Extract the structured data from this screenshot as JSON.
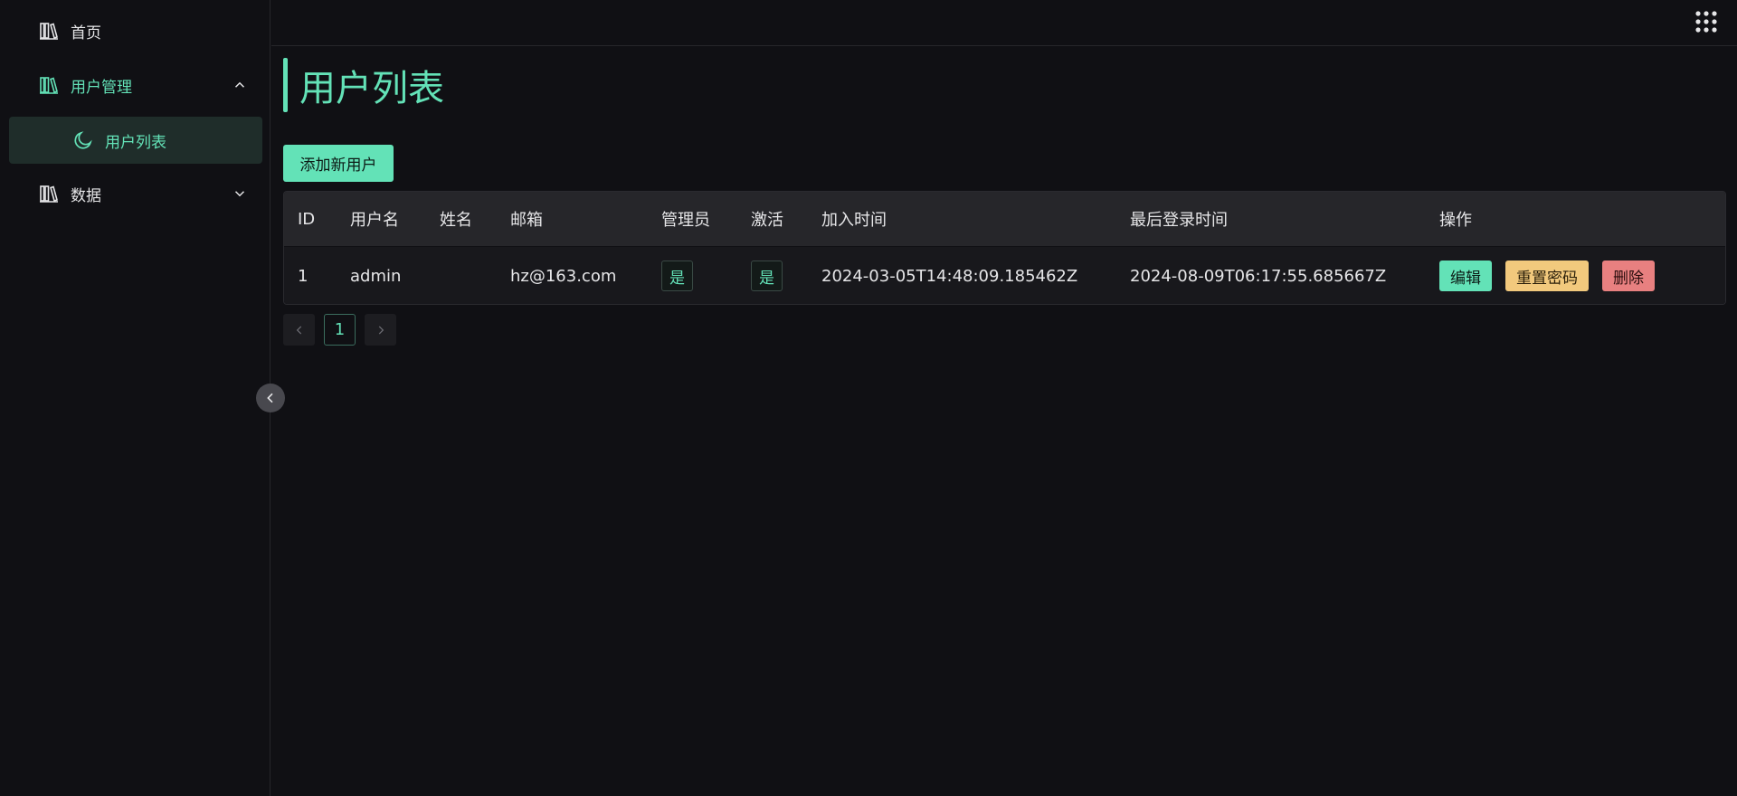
{
  "sidebar": {
    "items": [
      {
        "label": "首页",
        "icon": "library-icon"
      },
      {
        "label": "用户管理",
        "icon": "library-icon",
        "expanded": true
      },
      {
        "label": "数据",
        "icon": "library-icon",
        "expanded": false
      }
    ],
    "submenu": {
      "label": "用户列表",
      "icon": "moon-icon"
    }
  },
  "main": {
    "title": "用户列表",
    "add_button": "添加新用户",
    "table": {
      "headers": [
        "ID",
        "用户名",
        "姓名",
        "邮箱",
        "管理员",
        "激活",
        "加入时间",
        "最后登录时间",
        "操作"
      ],
      "rows": [
        {
          "id": "1",
          "username": "admin",
          "name": "",
          "email": "hz@163.com",
          "admin": "是",
          "active": "是",
          "joined": "2024-03-05T14:48:09.185462Z",
          "last_login": "2024-08-09T06:17:55.685667Z",
          "actions": {
            "edit": "编辑",
            "reset": "重置密码",
            "delete": "删除"
          }
        }
      ]
    },
    "pagination": {
      "current": "1"
    }
  },
  "colors": {
    "accent": "#63e2b7",
    "warning": "#f2c97d",
    "danger": "#e88080",
    "background": "#101014"
  }
}
